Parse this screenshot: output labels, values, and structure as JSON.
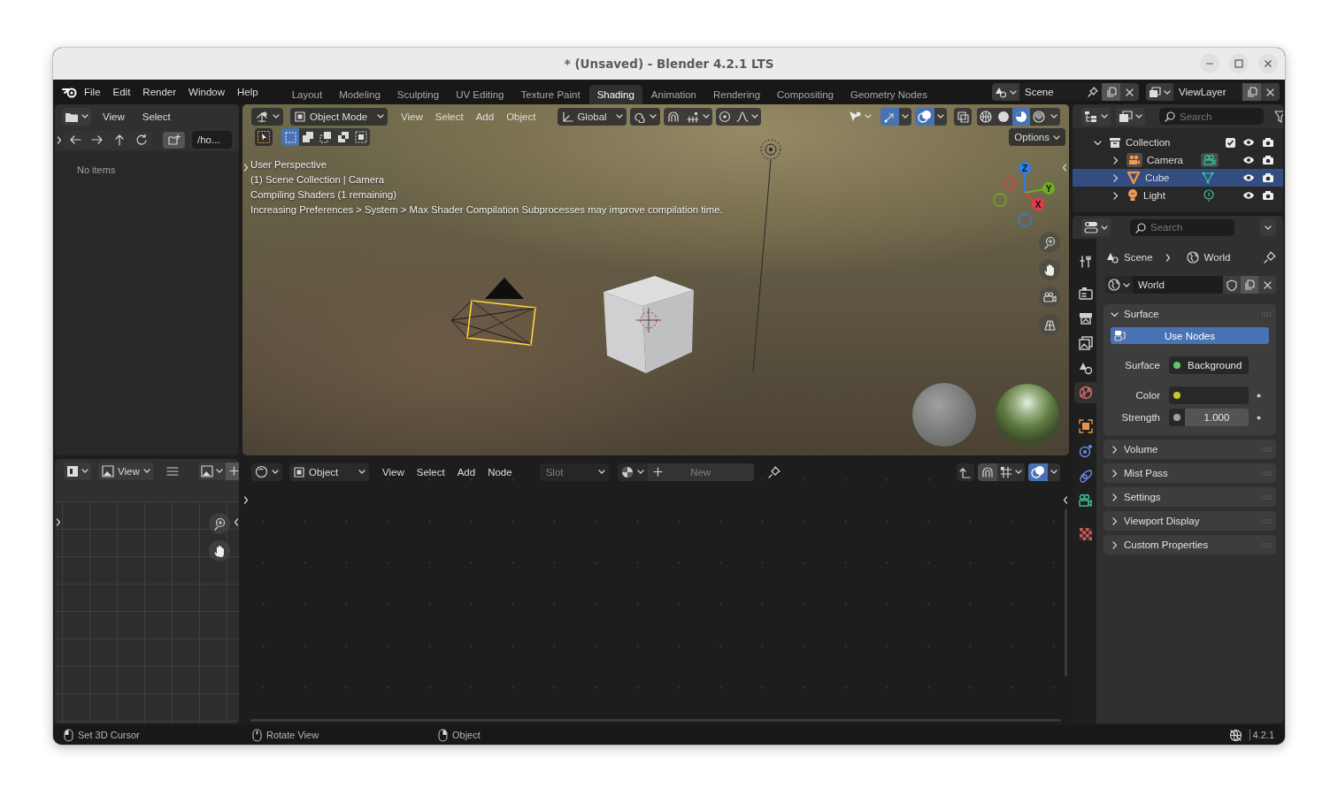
{
  "window": {
    "title": "* (Unsaved) - Blender 4.2.1 LTS"
  },
  "menu": [
    "File",
    "Edit",
    "Render",
    "Window",
    "Help"
  ],
  "workspaces": [
    {
      "label": "Layout",
      "selected": false
    },
    {
      "label": "Modeling",
      "selected": false
    },
    {
      "label": "Sculpting",
      "selected": false
    },
    {
      "label": "UV Editing",
      "selected": false
    },
    {
      "label": "Texture Paint",
      "selected": false
    },
    {
      "label": "Shading",
      "selected": true
    },
    {
      "label": "Animation",
      "selected": false
    },
    {
      "label": "Rendering",
      "selected": false
    },
    {
      "label": "Compositing",
      "selected": false
    },
    {
      "label": "Geometry Nodes",
      "selected": false
    }
  ],
  "scene": {
    "name": "Scene"
  },
  "view_layer": {
    "name": "ViewLayer"
  },
  "file_browser": {
    "menus": [
      "View",
      "Select"
    ],
    "path": "/ho...",
    "empty_text": "No items"
  },
  "viewport": {
    "mode": "Object Mode",
    "menus": [
      "View",
      "Select",
      "Add",
      "Object"
    ],
    "orientation": "Global",
    "gizmos": true,
    "overlays": true,
    "xray": false,
    "shading": [
      {
        "kind": "wireframe",
        "selected": false
      },
      {
        "kind": "solid",
        "selected": false
      },
      {
        "kind": "material",
        "selected": true
      },
      {
        "kind": "rendered",
        "selected": false
      }
    ],
    "select_modes": [
      {
        "kind": "new",
        "selected": true
      },
      {
        "kind": "extend",
        "selected": false
      },
      {
        "kind": "subtract",
        "selected": false
      },
      {
        "kind": "difference",
        "selected": false
      },
      {
        "kind": "intersect",
        "selected": false
      }
    ],
    "options": "Options",
    "info": [
      "User Perspective",
      "(1) Scene Collection | Camera",
      "Compiling Shaders (1 remaining)",
      "Increasing Preferences > System > Max Shader Compilation Subprocesses may improve compilation time."
    ],
    "axes": [
      {
        "label": "Z",
        "color": "#2f7fe0"
      },
      {
        "label": "Y",
        "color": "#6fae20"
      },
      {
        "label": "X",
        "color": "#e8374f"
      }
    ]
  },
  "image_editor": {
    "view": "View"
  },
  "node_editor": {
    "object_type": "Object",
    "menus": [
      "View",
      "Select",
      "Add",
      "Node"
    ],
    "slot": {
      "label": "Slot",
      "disabled": true
    },
    "new_button": {
      "label": "New",
      "disabled": true
    },
    "overlays": true
  },
  "outliner": {
    "search": {
      "placeholder": "Search"
    },
    "tree": [
      {
        "label": "Collection",
        "kind": "collection",
        "expanded": true,
        "checked": true,
        "selected": false,
        "children": [
          {
            "label": "Camera",
            "kind": "camera",
            "expanded": false,
            "selected": false
          },
          {
            "label": "Cube",
            "kind": "mesh",
            "expanded": false,
            "selected": true
          },
          {
            "label": "Light",
            "kind": "light",
            "expanded": false,
            "selected": false
          }
        ]
      }
    ]
  },
  "properties": {
    "search": {
      "placeholder": "Search"
    },
    "tabs": [
      {
        "kind": "tool",
        "selected": false
      },
      {
        "kind": "render",
        "selected": false
      },
      {
        "kind": "output",
        "selected": false
      },
      {
        "kind": "view_layer",
        "selected": false
      },
      {
        "kind": "scene",
        "selected": false
      },
      {
        "kind": "world",
        "selected": true
      },
      {
        "kind": "object",
        "selected": false
      },
      {
        "kind": "physics",
        "selected": false
      },
      {
        "kind": "constraints",
        "selected": false
      },
      {
        "kind": "data",
        "selected": false
      },
      {
        "kind": "texture",
        "selected": false
      }
    ],
    "breadcrumb": [
      "Scene",
      "World"
    ],
    "world": {
      "name": "World"
    },
    "panels": [
      {
        "label": "Surface",
        "expanded": true,
        "use_nodes": "Use Nodes",
        "fields": [
          {
            "kind": "shader",
            "label": "Surface",
            "value": "Background",
            "color": "#63c763"
          },
          {
            "kind": "color",
            "label": "Color",
            "color": "#c7c729"
          },
          {
            "kind": "value",
            "label": "Strength",
            "value": "1.000",
            "color": "#a1a1a1"
          }
        ]
      },
      {
        "label": "Volume",
        "expanded": false
      },
      {
        "label": "Mist Pass",
        "expanded": false
      },
      {
        "label": "Settings",
        "expanded": false
      },
      {
        "label": "Viewport Display",
        "expanded": false
      },
      {
        "label": "Custom Properties",
        "expanded": false
      }
    ]
  },
  "status_bar": {
    "hints": [
      {
        "kind": "left",
        "label": "Set 3D Cursor"
      },
      {
        "kind": "middle",
        "label": "Rotate View"
      },
      {
        "kind": "right",
        "label": "Object"
      }
    ],
    "version": "4.2.1"
  }
}
